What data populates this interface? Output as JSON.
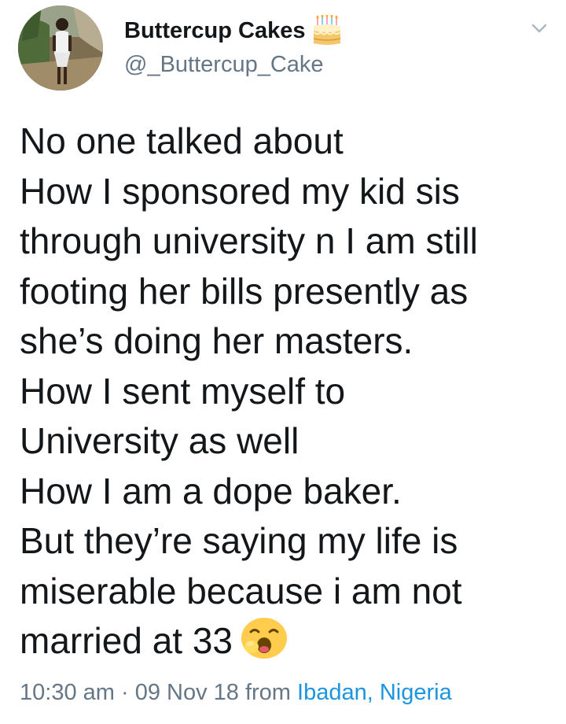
{
  "tweet": {
    "author": {
      "display_name": "Buttercup Cakes",
      "handle": "@_Buttercup_Cake",
      "name_emoji_icon": "birthday-cake-icon"
    },
    "menu_icon": "chevron-down-icon",
    "body_lines": [
      "No one talked about",
      "How I sponsored my kid sis",
      "through university n I am still",
      "footing her bills presently as",
      "she’s doing her masters.",
      "How I sent myself to",
      "University as well",
      "How I am a dope baker.",
      "But they’re saying my life is",
      "miserable because i am not",
      "married at 33"
    ],
    "body_end_emoji_icon": "yawning-face-icon",
    "time": "10:30 am",
    "separator": " · ",
    "date": "09 Nov 18",
    "from_label": " from ",
    "location": "Ibadan, Nigeria"
  },
  "colors": {
    "text_primary": "#14171a",
    "text_secondary": "#657786",
    "link_blue": "#1b95e0"
  }
}
